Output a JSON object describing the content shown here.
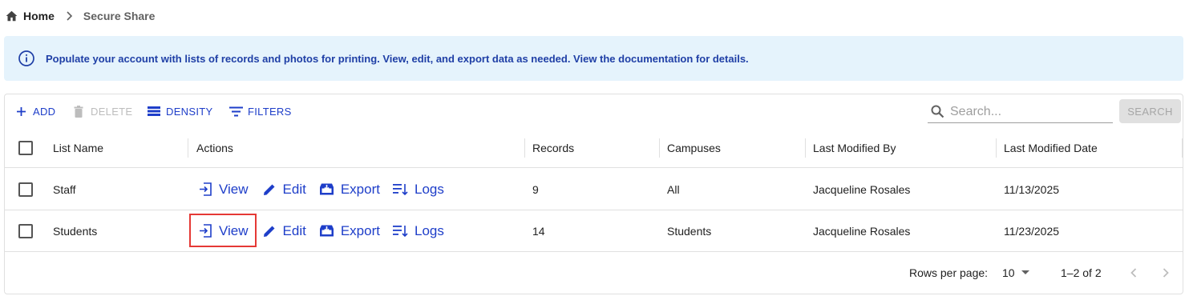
{
  "breadcrumb": {
    "home": "Home",
    "current": "Secure Share"
  },
  "alert": {
    "text": "Populate your account with lists of records and photos for printing. View, edit, and export data as needed. View the documentation for details."
  },
  "toolbar": {
    "add": "ADD",
    "delete": "DELETE",
    "density": "DENSITY",
    "filters": "FILTERS",
    "search_placeholder": "Search...",
    "search_button": "SEARCH"
  },
  "columns": [
    "List Name",
    "Actions",
    "Records",
    "Campuses",
    "Last Modified By",
    "Last Modified Date"
  ],
  "actions": {
    "view": "View",
    "edit": "Edit",
    "export": "Export",
    "logs": "Logs"
  },
  "rows": [
    {
      "list_name": "Staff",
      "records": "9",
      "campuses": "All",
      "modified_by": "Jacqueline Rosales",
      "modified_date": "11/13/2025"
    },
    {
      "list_name": "Students",
      "records": "14",
      "campuses": "Students",
      "modified_by": "Jacqueline Rosales",
      "modified_date": "11/23/2025"
    }
  ],
  "footer": {
    "rows_per_page_label": "Rows per page:",
    "rows_per_page_value": "10",
    "range": "1–2 of 2"
  },
  "colors": {
    "accent": "#1e3ec9",
    "alert_bg": "#e5f3fc",
    "alert_text": "#1f3fa6",
    "highlight": "#e53935"
  }
}
